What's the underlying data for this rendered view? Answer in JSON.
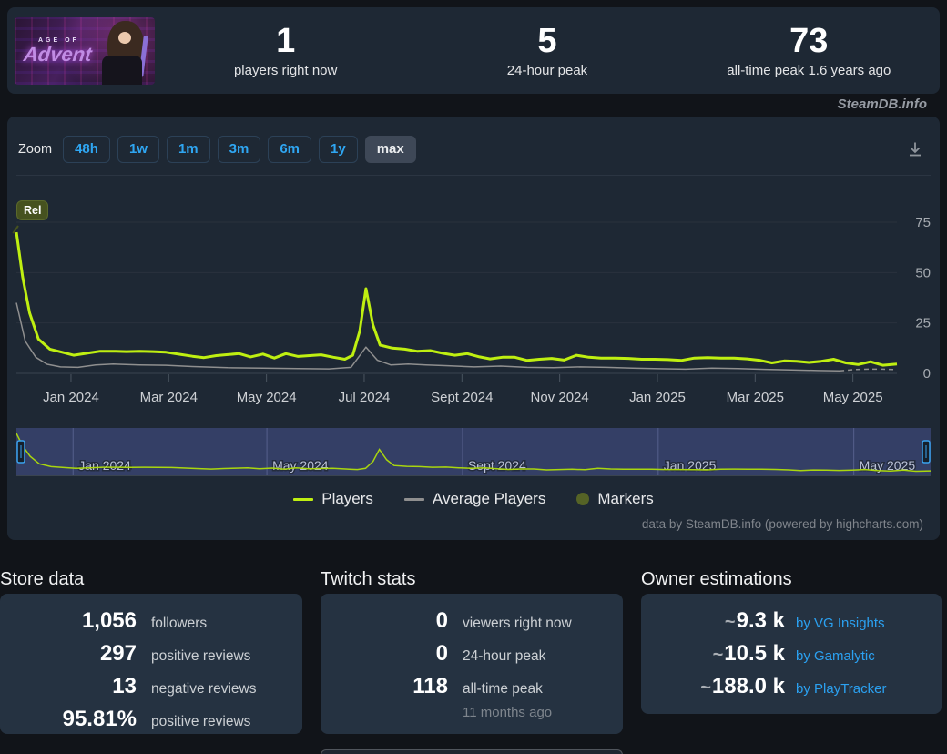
{
  "meta": {
    "watermark": "SteamDB.info",
    "credits": "data by SteamDB.info (powered by highcharts.com)"
  },
  "header": {
    "banner": {
      "tagline": "AGE OF",
      "title": "Advent"
    },
    "stats": [
      {
        "value": "1",
        "label": "players right now"
      },
      {
        "value": "5",
        "label": "24-hour peak"
      },
      {
        "value": "73",
        "label": "all-time peak 1.6 years ago"
      }
    ]
  },
  "toolbar": {
    "zoom_label": "Zoom",
    "ranges": [
      "48h",
      "1w",
      "1m",
      "3m",
      "6m",
      "1y",
      "max"
    ],
    "active_range": "max",
    "download_icon": "download-icon"
  },
  "chart_data": {
    "type": "line",
    "title": "",
    "release_marker": {
      "label": "Rel",
      "frac": 0.0
    },
    "y_axis": {
      "ticks": [
        0,
        25,
        50,
        75
      ],
      "position": "right",
      "max": 90
    },
    "x_axis": {
      "labels": [
        "Jan 2024",
        "Mar 2024",
        "May 2024",
        "Jul 2024",
        "Sept 2024",
        "Nov 2024",
        "Jan 2025",
        "Mar 2025",
        "May 2025"
      ],
      "label_fracs": [
        0.062,
        0.173,
        0.284,
        0.395,
        0.506,
        0.617,
        0.728,
        0.839,
        0.95
      ]
    },
    "legend": [
      {
        "label": "Players",
        "swatch": "line",
        "color": "#bfef11"
      },
      {
        "label": "Average Players",
        "swatch": "line",
        "color": "#8f8f8f"
      },
      {
        "label": "Markers",
        "swatch": "circle",
        "color": "#556326"
      }
    ],
    "series": [
      {
        "name": "Players",
        "color": "#bfef11",
        "width": 3,
        "points": [
          [
            0.0,
            70
          ],
          [
            0.007,
            48
          ],
          [
            0.015,
            30
          ],
          [
            0.025,
            17
          ],
          [
            0.038,
            12
          ],
          [
            0.052,
            10.5
          ],
          [
            0.065,
            9
          ],
          [
            0.08,
            10
          ],
          [
            0.095,
            11
          ],
          [
            0.11,
            11
          ],
          [
            0.125,
            10.8
          ],
          [
            0.14,
            11
          ],
          [
            0.155,
            10.8
          ],
          [
            0.17,
            10.5
          ],
          [
            0.185,
            9.5
          ],
          [
            0.2,
            8.5
          ],
          [
            0.213,
            7.8
          ],
          [
            0.227,
            8.8
          ],
          [
            0.24,
            9.3
          ],
          [
            0.253,
            9.8
          ],
          [
            0.266,
            8.2
          ],
          [
            0.28,
            9.6
          ],
          [
            0.293,
            7.6
          ],
          [
            0.306,
            9.8
          ],
          [
            0.32,
            8.4
          ],
          [
            0.333,
            8.8
          ],
          [
            0.346,
            9.2
          ],
          [
            0.36,
            8
          ],
          [
            0.373,
            7
          ],
          [
            0.382,
            9
          ],
          [
            0.39,
            21
          ],
          [
            0.397,
            42
          ],
          [
            0.405,
            24
          ],
          [
            0.413,
            14
          ],
          [
            0.427,
            12.5
          ],
          [
            0.441,
            12
          ],
          [
            0.455,
            11
          ],
          [
            0.47,
            11.3
          ],
          [
            0.484,
            10
          ],
          [
            0.498,
            9
          ],
          [
            0.512,
            9.8
          ],
          [
            0.526,
            8.2
          ],
          [
            0.538,
            7.2
          ],
          [
            0.552,
            8
          ],
          [
            0.566,
            8
          ],
          [
            0.58,
            6.4
          ],
          [
            0.594,
            7
          ],
          [
            0.608,
            7.4
          ],
          [
            0.622,
            6.6
          ],
          [
            0.636,
            9
          ],
          [
            0.65,
            8
          ],
          [
            0.664,
            7.6
          ],
          [
            0.68,
            7.6
          ],
          [
            0.695,
            7.4
          ],
          [
            0.71,
            7
          ],
          [
            0.725,
            7
          ],
          [
            0.74,
            6.8
          ],
          [
            0.755,
            6.4
          ],
          [
            0.77,
            7.6
          ],
          [
            0.785,
            7.8
          ],
          [
            0.8,
            7.6
          ],
          [
            0.815,
            7.6
          ],
          [
            0.83,
            7.2
          ],
          [
            0.845,
            6.4
          ],
          [
            0.858,
            5.2
          ],
          [
            0.872,
            6.2
          ],
          [
            0.886,
            6
          ],
          [
            0.9,
            5.4
          ],
          [
            0.914,
            6
          ],
          [
            0.928,
            7
          ],
          [
            0.942,
            5.2
          ],
          [
            0.956,
            4.4
          ],
          [
            0.97,
            5.8
          ],
          [
            0.984,
            4
          ],
          [
            1.0,
            4.6
          ]
        ]
      },
      {
        "name": "Average Players",
        "color": "#8f8f8f",
        "width": 1.5,
        "points": [
          [
            0.0,
            35
          ],
          [
            0.01,
            16
          ],
          [
            0.022,
            8
          ],
          [
            0.035,
            4.5
          ],
          [
            0.05,
            3.2
          ],
          [
            0.07,
            3
          ],
          [
            0.09,
            4.2
          ],
          [
            0.11,
            4.6
          ],
          [
            0.14,
            4.2
          ],
          [
            0.17,
            4
          ],
          [
            0.2,
            3.4
          ],
          [
            0.24,
            2.8
          ],
          [
            0.28,
            2.6
          ],
          [
            0.32,
            2.4
          ],
          [
            0.355,
            2.2
          ],
          [
            0.38,
            3
          ],
          [
            0.397,
            13
          ],
          [
            0.41,
            6.5
          ],
          [
            0.425,
            4.2
          ],
          [
            0.445,
            4.6
          ],
          [
            0.465,
            4.2
          ],
          [
            0.49,
            3.8
          ],
          [
            0.52,
            3.2
          ],
          [
            0.55,
            3.6
          ],
          [
            0.58,
            3
          ],
          [
            0.61,
            2.8
          ],
          [
            0.64,
            3.2
          ],
          [
            0.67,
            3
          ],
          [
            0.7,
            2.6
          ],
          [
            0.73,
            2.3
          ],
          [
            0.76,
            2.1
          ],
          [
            0.79,
            2.6
          ],
          [
            0.82,
            2.4
          ],
          [
            0.85,
            2
          ],
          [
            0.88,
            1.7
          ],
          [
            0.91,
            1.4
          ],
          [
            0.935,
            1.2
          ]
        ],
        "dashed_tail": [
          [
            0.935,
            1.2
          ],
          [
            0.952,
            1.9
          ],
          [
            0.968,
            2.1
          ],
          [
            0.984,
            2.1
          ],
          [
            1.0,
            1.9
          ]
        ]
      }
    ],
    "navigator": {
      "mask_color": "#4f5ba3",
      "line_color": "#a9d60e",
      "handle_color": "#3aa2ee",
      "labels": [
        {
          "text": "Jan 2024",
          "frac": 0.062
        },
        {
          "text": "May 2024",
          "frac": 0.274
        },
        {
          "text": "Sept 2024",
          "frac": 0.488
        },
        {
          "text": "Jan 2025",
          "frac": 0.702
        },
        {
          "text": "May 2025",
          "frac": 0.916
        }
      ]
    }
  },
  "cards": {
    "store": {
      "title": "Store data",
      "rows": [
        {
          "value": "1,056",
          "label": "followers"
        },
        {
          "value": "297",
          "label": "positive reviews"
        },
        {
          "value": "13",
          "label": "negative reviews"
        },
        {
          "value": "95.81%",
          "label": "positive reviews"
        }
      ]
    },
    "twitch": {
      "title": "Twitch stats",
      "rows": [
        {
          "value": "0",
          "label": "viewers right now"
        },
        {
          "value": "0",
          "label": "24-hour peak"
        },
        {
          "value": "118",
          "label": "all-time peak",
          "sub": "11 months ago"
        }
      ]
    },
    "owners": {
      "title": "Owner estimations",
      "rows": [
        {
          "approx": "~",
          "value": "9.3 k",
          "link": "by VG Insights"
        },
        {
          "approx": "~",
          "value": "10.5 k",
          "link": "by Gamalytic"
        },
        {
          "approx": "~",
          "value": "188.0 k",
          "link": "by PlayTracker"
        }
      ]
    }
  },
  "colors": {
    "accent_blue": "#2fa6f2",
    "players_line": "#bfef11",
    "average_line": "#8f8f8f",
    "marker_olive": "#556326",
    "card_bg": "#1e2834",
    "sub_card_bg": "#253241"
  }
}
